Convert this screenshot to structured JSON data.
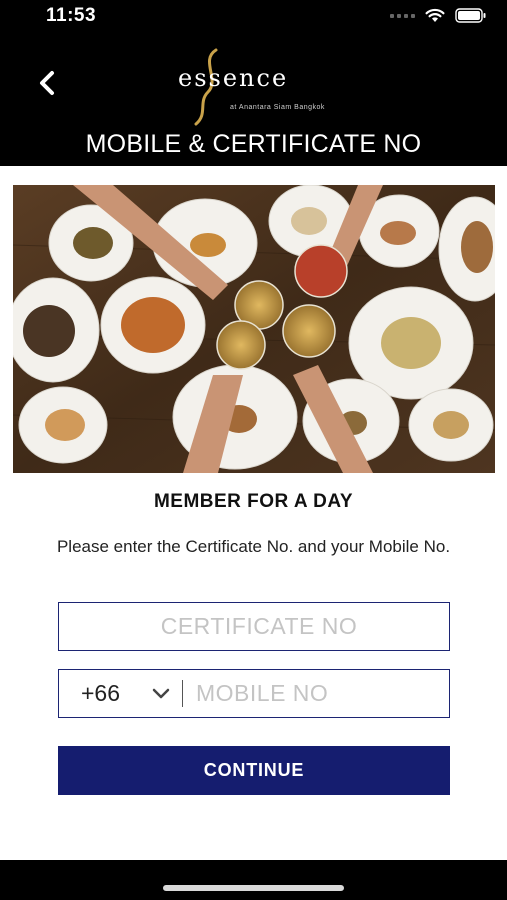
{
  "status_bar": {
    "time": "11:53",
    "icons": [
      "cellular-icon",
      "wifi-icon",
      "battery-icon"
    ]
  },
  "header": {
    "back_icon": "chevron-left-icon",
    "logo_word": "essence",
    "logo_subtitle": "at Anantara Siam Bangkok",
    "title": "MOBILE & CERTIFICATE NO"
  },
  "hero": {
    "icon": "dining-photo"
  },
  "form": {
    "heading": "MEMBER FOR A DAY",
    "instructions": "Please enter the Certificate No. and your Mobile No.",
    "certificate_placeholder": "CERTIFICATE NO",
    "country_code": "+66",
    "mobile_placeholder": "MOBILE NO",
    "continue_label": "CONTINUE"
  },
  "colors": {
    "header_bg": "#000000",
    "accent_navy": "#151d6f",
    "field_border": "#1c2473",
    "logo_gold": "#c9a24a",
    "placeholder": "#c4c4c4"
  }
}
